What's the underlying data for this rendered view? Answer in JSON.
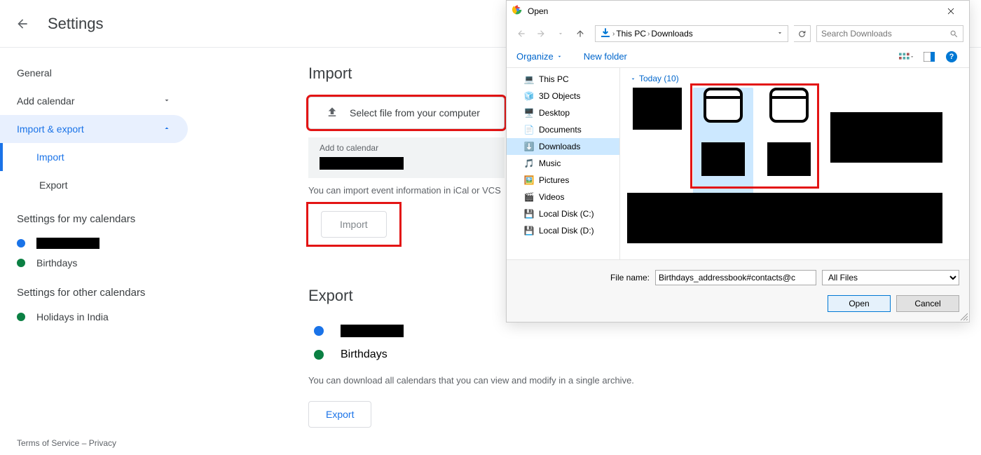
{
  "header": {
    "title": "Settings"
  },
  "sidebar": {
    "general": "General",
    "add_calendar": "Add calendar",
    "import_export": "Import & export",
    "sub": {
      "import": "Import",
      "export": "Export"
    },
    "my_calendars_title": "Settings for my calendars",
    "my_calendars": [
      {
        "color": "#1a73e8",
        "label": ""
      },
      {
        "color": "#0b8043",
        "label": "Birthdays"
      }
    ],
    "other_calendars_title": "Settings for other calendars",
    "other_calendars": [
      {
        "color": "#0b8043",
        "label": "Holidays in India"
      }
    ]
  },
  "footer": {
    "terms": "Terms of Service",
    "sep": " – ",
    "privacy": "Privacy"
  },
  "import_section": {
    "title": "Import",
    "select_file": "Select file from your computer",
    "add_to_calendar_label": "Add to calendar",
    "hint": "You can import event information in iCal or VCS",
    "button": "Import"
  },
  "export_section": {
    "title": "Export",
    "calendars": [
      {
        "color": "#1a73e8",
        "label": ""
      },
      {
        "color": "#0b8043",
        "label": "Birthdays"
      }
    ],
    "hint": "You can download all calendars that you can view and modify in a single archive.",
    "button": "Export"
  },
  "dialog": {
    "title": "Open",
    "breadcrumb": [
      "This PC",
      "Downloads"
    ],
    "search_placeholder": "Search Downloads",
    "organize": "Organize",
    "new_folder": "New folder",
    "tree": [
      {
        "icon": "pc",
        "label": "This PC",
        "sel": false
      },
      {
        "icon": "3d",
        "label": "3D Objects",
        "sel": false
      },
      {
        "icon": "desktop",
        "label": "Desktop",
        "sel": false
      },
      {
        "icon": "docs",
        "label": "Documents",
        "sel": false
      },
      {
        "icon": "downloads",
        "label": "Downloads",
        "sel": true
      },
      {
        "icon": "music",
        "label": "Music",
        "sel": false
      },
      {
        "icon": "pictures",
        "label": "Pictures",
        "sel": false
      },
      {
        "icon": "videos",
        "label": "Videos",
        "sel": false
      },
      {
        "icon": "disk",
        "label": "Local Disk (C:)",
        "sel": false
      },
      {
        "icon": "disk",
        "label": "Local Disk (D:)",
        "sel": false
      }
    ],
    "group": "Today (10)",
    "filename_label": "File name:",
    "filename_value": "Birthdays_addressbook#contacts@c",
    "filter": "All Files",
    "open_btn": "Open",
    "cancel_btn": "Cancel"
  }
}
